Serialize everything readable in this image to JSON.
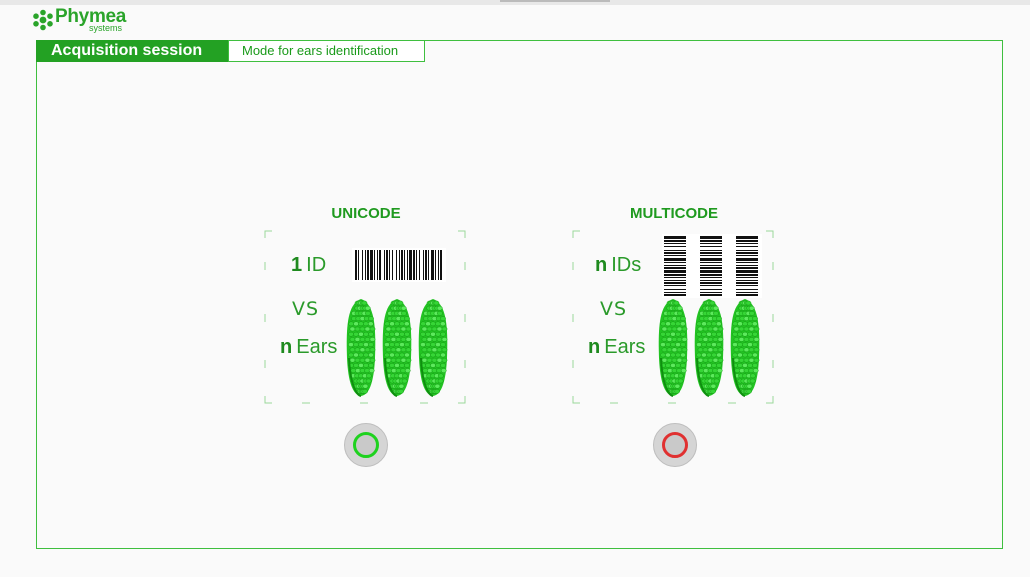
{
  "header": {
    "logo_name": "Phymea",
    "logo_sub": "systems"
  },
  "session": {
    "title": "Acquisition session",
    "mode_label": "Mode for ears identification"
  },
  "modes": [
    {
      "title": "UNICODE",
      "id_count": "1",
      "id_label": "ID",
      "vs": "VS",
      "ears_count": "n",
      "ears_label": "Ears",
      "status_color": "#1ed21e",
      "status": "selected"
    },
    {
      "title": "MULTICODE",
      "id_count": "n",
      "id_label": "IDs",
      "vs": "VS",
      "ears_count": "n",
      "ears_label": "Ears",
      "status_color": "#e03030",
      "status": "not-selected"
    }
  ],
  "colors": {
    "brand_green": "#23a123",
    "frame_green": "#3fbf3f",
    "selected": "#1ed21e",
    "unselected": "#e03030"
  }
}
